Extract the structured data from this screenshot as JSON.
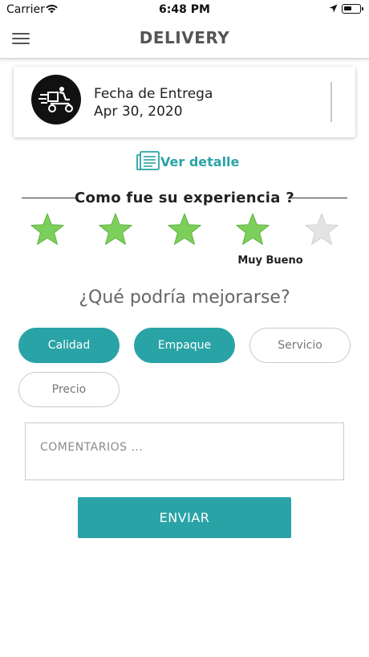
{
  "status_bar": {
    "carrier": "Carrier",
    "time": "6:48 PM"
  },
  "nav": {
    "title": "DELIVERY"
  },
  "delivery_card": {
    "label": "Fecha de Entrega",
    "date": "Apr 30, 2020",
    "icon": "delivery-scooter-icon"
  },
  "detail_link": {
    "label": "Ver detalle",
    "icon": "document-list-icon"
  },
  "experience": {
    "title": "Como fue su experiencia ?",
    "stars_total": 5,
    "stars_selected": 4,
    "rating_label": "Muy Bueno",
    "star_on_color": "#7ccf5a",
    "star_off_color": "#e3e3e3"
  },
  "improve": {
    "title": "¿Qué podría mejorarse?",
    "options": [
      {
        "label": "Calidad",
        "selected": true
      },
      {
        "label": "Empaque",
        "selected": true
      },
      {
        "label": "Servicio",
        "selected": false
      },
      {
        "label": "Precio",
        "selected": false
      }
    ]
  },
  "comments": {
    "placeholder": "COMENTARIOS ..."
  },
  "send_button": {
    "label": "ENVIAR"
  },
  "colors": {
    "accent": "#2aa3a6"
  }
}
